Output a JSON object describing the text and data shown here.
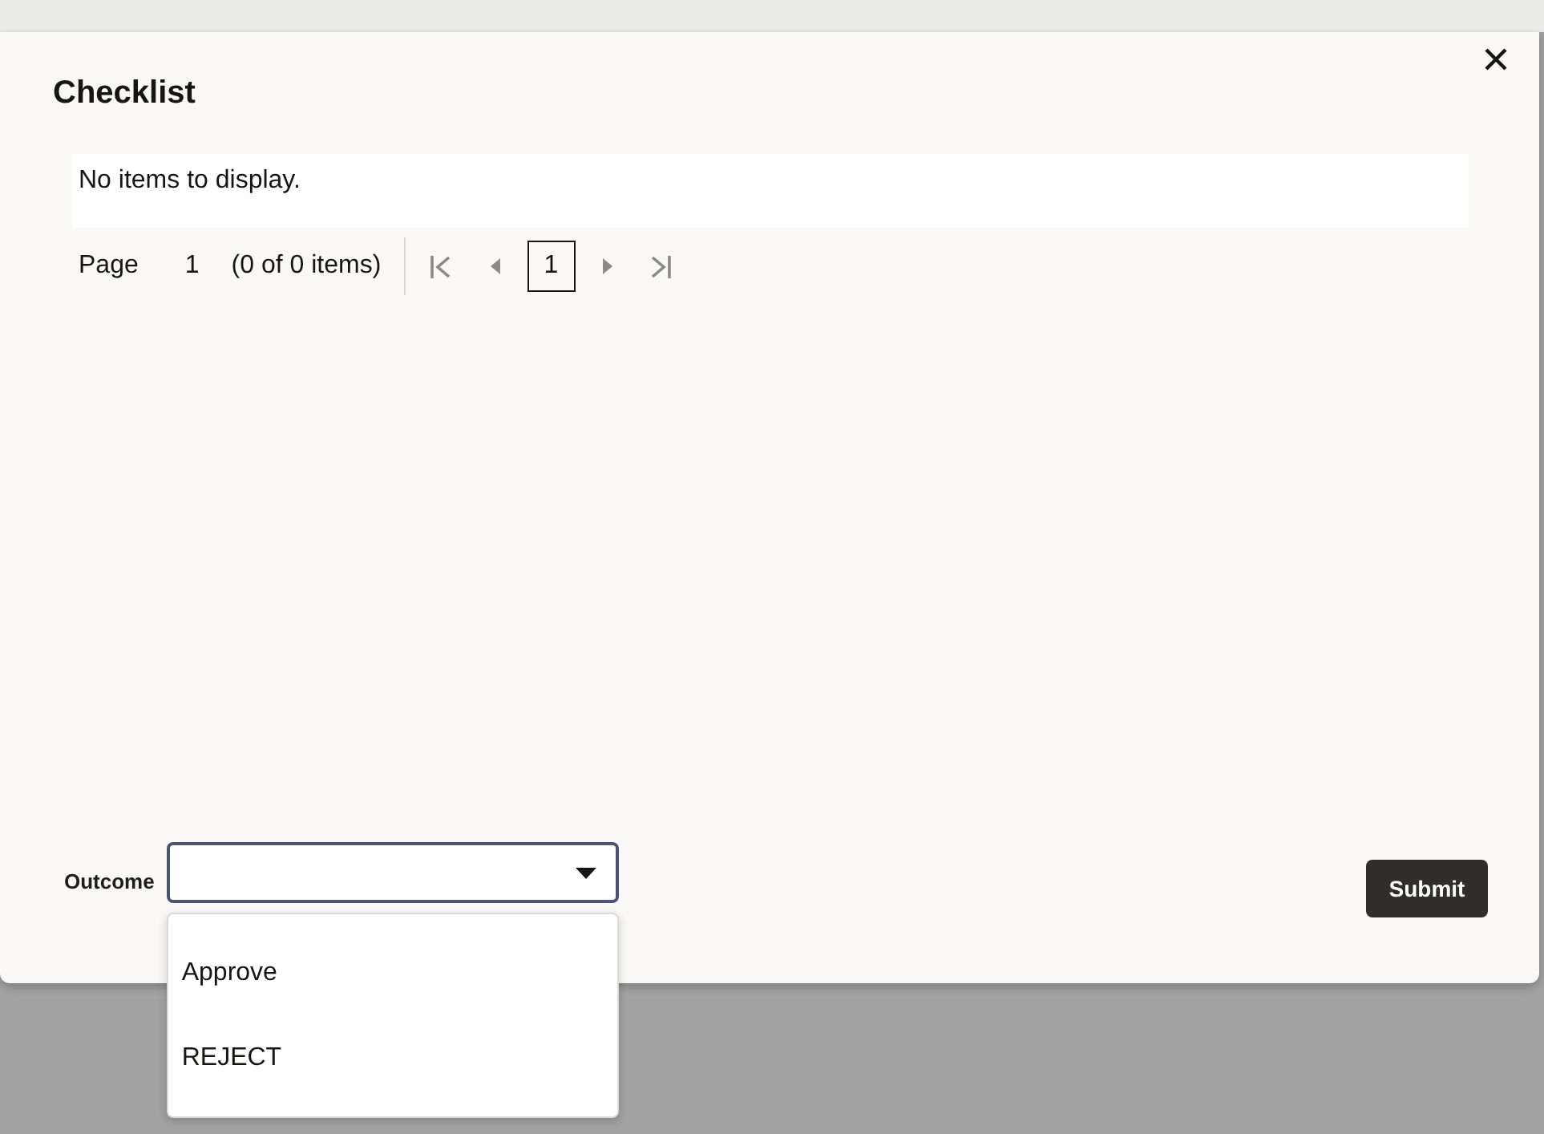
{
  "dialog": {
    "title": "Checklist"
  },
  "table": {
    "empty_message": "No items to display."
  },
  "pagination": {
    "page_label": "Page",
    "current_page": "1",
    "summary": "(0 of 0 items)",
    "buttons_before": [
      {
        "kind": "first",
        "disabled": true
      },
      {
        "kind": "previous",
        "disabled": true
      }
    ],
    "pages": [
      {
        "label": "1",
        "selected": true
      }
    ],
    "buttons_after": [
      {
        "kind": "next",
        "disabled": true
      },
      {
        "kind": "last",
        "disabled": true
      }
    ]
  },
  "outcome": {
    "label": "Outcome",
    "expanded": true,
    "options": [
      {
        "label": "Approve",
        "selected": false
      },
      {
        "label": "REJECT",
        "selected": false
      }
    ]
  },
  "actions": [
    {
      "label": "Submit"
    }
  ]
}
